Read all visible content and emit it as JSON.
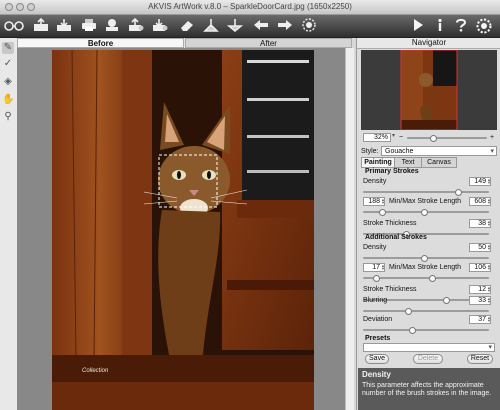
{
  "window": {
    "title": "AKVIS ArtWork v.8.0 – SparkleDoorCard.jpg (1650x2250)"
  },
  "toolbar": {
    "left_icons": [
      "glasses-icon",
      "open-icon",
      "save-icon",
      "print-icon",
      "share-icon",
      "batch-icon",
      "batch-preset-icon",
      "eraser-icon",
      "import-icon",
      "export-icon",
      "back-icon",
      "forward-icon",
      "settings-icon"
    ],
    "right_icons": [
      "run-icon",
      "info-icon",
      "help-icon",
      "preferences-icon"
    ]
  },
  "view_tabs": {
    "before": "Before",
    "after": "After"
  },
  "watermark": "Collection",
  "navigator": {
    "title": "Navigator",
    "zoom": "32%",
    "zoom_fraction": 0.32
  },
  "style": {
    "label": "Style:",
    "value": "Gouache"
  },
  "tabs": {
    "painting": "Painting",
    "text": "Text",
    "canvas": "Canvas"
  },
  "primary": {
    "title": "Primary Strokes",
    "density_label": "Density",
    "density": "149",
    "minmax_label": "Min/Max Stroke Length",
    "min": "188",
    "max": "608",
    "thickness_label": "Stroke Thickness",
    "thickness": "38"
  },
  "additional": {
    "title": "Additional Strokes",
    "density_label": "Density",
    "density": "50",
    "minmax_label": "Min/Max Stroke Length",
    "min": "17",
    "max": "106",
    "thickness_label": "Stroke Thickness",
    "thickness": "12"
  },
  "blurring": {
    "label": "Blurring",
    "value": "33"
  },
  "deviation": {
    "label": "Deviation",
    "value": "37"
  },
  "presets": {
    "title": "Presets",
    "save": "Save",
    "delete": "Delete",
    "reset": "Reset"
  },
  "help": {
    "title": "Density",
    "text": "This parameter affects the approximate number of the brush strokes in the image."
  }
}
